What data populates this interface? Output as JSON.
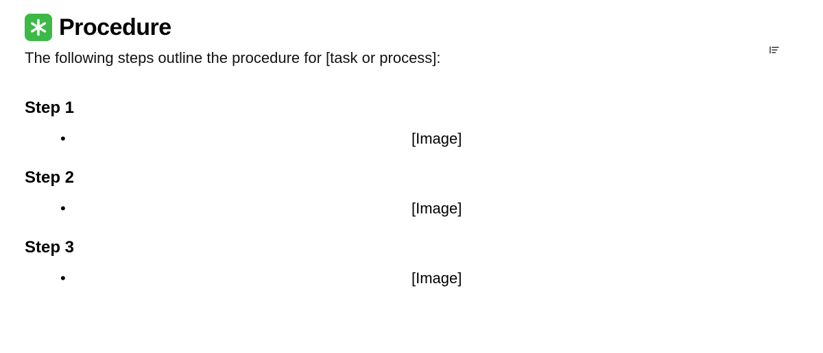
{
  "header": {
    "title": "Procedure",
    "icon_name": "asterisk"
  },
  "intro": "The following steps outline the procedure for [task or process]:",
  "steps": [
    {
      "title": "Step 1",
      "image_placeholder": "[Image]"
    },
    {
      "title": "Step 2",
      "image_placeholder": "[Image]"
    },
    {
      "title": "Step 3",
      "image_placeholder": "[Image]"
    }
  ],
  "toolbar": {
    "outline_button": "Outline"
  }
}
